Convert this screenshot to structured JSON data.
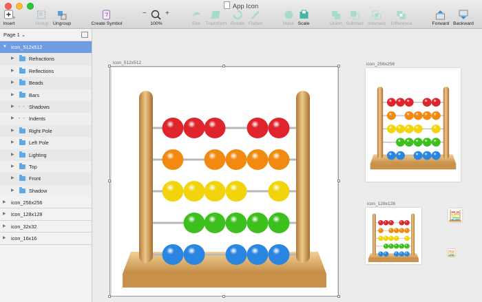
{
  "window": {
    "title": "App Icon"
  },
  "toolbar": {
    "insert": "Insert",
    "group": "Group",
    "ungroup": "Ungroup",
    "create_symbol": "Create Symbol",
    "zoom_minus": "−",
    "zoom_plus": "+",
    "zoom_value": "100%",
    "edit": "Edit",
    "transform": "Transform",
    "rotate": "Rotate",
    "flatten": "Flatten",
    "mask": "Mask",
    "scale": "Scale",
    "union": "Union",
    "subtract": "Subtract",
    "intersect": "Intersect",
    "difference": "Difference",
    "forward": "Forward",
    "backward": "Backward"
  },
  "sidebar": {
    "page": "Page 1 ⌄",
    "layers": [
      {
        "name": "icon_512x512",
        "kind": "artboard",
        "selected": true
      },
      {
        "name": "Refractions",
        "kind": "folder"
      },
      {
        "name": "Reflections",
        "kind": "folder"
      },
      {
        "name": "Beads",
        "kind": "folder"
      },
      {
        "name": "Bars",
        "kind": "folder"
      },
      {
        "name": "Shadows",
        "kind": "shape"
      },
      {
        "name": "Indents",
        "kind": "shape"
      },
      {
        "name": "Right Pole",
        "kind": "folder"
      },
      {
        "name": "Left Pole",
        "kind": "folder"
      },
      {
        "name": "Lighting",
        "kind": "folder"
      },
      {
        "name": "Top",
        "kind": "folder"
      },
      {
        "name": "Front",
        "kind": "folder"
      },
      {
        "name": "Shadow",
        "kind": "folder"
      },
      {
        "name": "icon_256x256",
        "kind": "artboard"
      },
      {
        "name": "icon_128x128",
        "kind": "artboard"
      },
      {
        "name": "icon_32x32",
        "kind": "artboard"
      },
      {
        "name": "icon_16x16",
        "kind": "artboard"
      }
    ]
  },
  "canvas": {
    "artboard_labels": [
      "icon_512x512",
      "icon_256x256",
      "icon_128x128"
    ]
  },
  "abacus": {
    "bead_colors": [
      "#e0242c",
      "#f28a12",
      "#f2d40c",
      "#3dbf1e",
      "#2a86e0"
    ],
    "wood": "#d9a760",
    "rows": [
      [
        1,
        1,
        1,
        0,
        1,
        1,
        0
      ],
      [
        1,
        0,
        1,
        1,
        1,
        1,
        0
      ],
      [
        1,
        1,
        1,
        1,
        0,
        1,
        0
      ],
      [
        0,
        1,
        1,
        1,
        1,
        1,
        0
      ],
      [
        1,
        1,
        0,
        1,
        1,
        1,
        0
      ]
    ]
  }
}
